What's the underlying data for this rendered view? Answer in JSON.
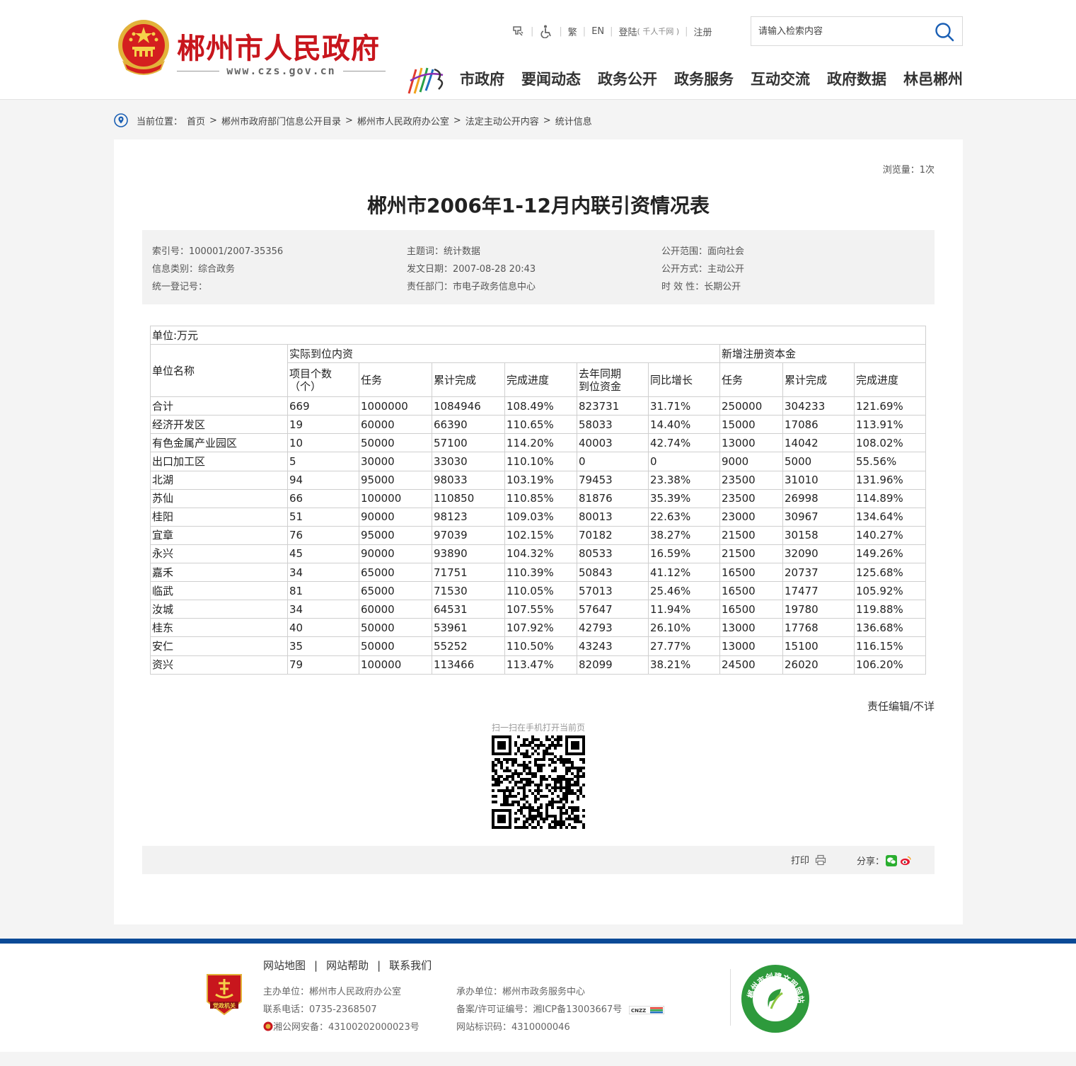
{
  "header": {
    "site_title": "郴州市人民政府",
    "site_url": "www.czs.gov.cn",
    "top_links": {
      "traditional": "繁",
      "english": "EN",
      "login": "登陆",
      "login_note": "( 千人千网 )",
      "register": "注册"
    },
    "search_placeholder": "请输入检索内容",
    "nav": [
      "市政府",
      "要闻动态",
      "政务公开",
      "政务服务",
      "互动交流",
      "政府数据",
      "林邑郴州"
    ]
  },
  "breadcrumb": {
    "label": "当前位置：",
    "items": [
      "首页",
      "郴州市政府部门信息公开目录",
      "郴州市人民政府办公室",
      "法定主动公开内容",
      "统计信息"
    ]
  },
  "article": {
    "views": "浏览量：1次",
    "title": "郴州市2006年1-12月内联引资情况表",
    "meta": {
      "index_no": "索引号：100001/2007-35356",
      "subject": "主题词：统计数据",
      "scope": "公开范围：面向社会",
      "category": "信息类别：综合政务",
      "date": "发文日期：2007-08-28 20:43",
      "method": "公开方式：主动公开",
      "reg_no": "统一登记号：",
      "dept": "责任部门：市电子政务信息中心",
      "validity": "时 效 性：长期公开"
    },
    "editor": "责任编辑/不详",
    "qr_caption": "扫一扫在手机打开当前页",
    "print_label": "打印",
    "share_label": "分享："
  },
  "table": {
    "unit": "单位:万元",
    "col_unit_name": "单位名称",
    "group1": "实际到位内资",
    "group2": "新增注册资本金",
    "subheaders": [
      "项目个数\n（个）",
      "任务",
      "累计完成",
      "完成进度",
      "去年同期\n到位资金",
      "同比增长",
      "任务",
      "累计完成",
      "完成进度"
    ],
    "rows": [
      [
        "合计",
        "669",
        "1000000",
        "1084946",
        "108.49%",
        "823731",
        "31.71%",
        "250000",
        "304233",
        "121.69%"
      ],
      [
        "经济开发区",
        "19",
        "60000",
        "66390",
        "110.65%",
        "58033",
        "14.40%",
        "15000",
        "17086",
        "113.91%"
      ],
      [
        "有色金属产业园区",
        "10",
        "50000",
        "57100",
        "114.20%",
        "40003",
        "42.74%",
        "13000",
        "14042",
        "108.02%"
      ],
      [
        "出口加工区",
        "5",
        "30000",
        "33030",
        "110.10%",
        "0",
        "0",
        "9000",
        "5000",
        "55.56%"
      ],
      [
        "北湖",
        "94",
        "95000",
        "98033",
        "103.19%",
        "79453",
        "23.38%",
        "23500",
        "31010",
        "131.96%"
      ],
      [
        "苏仙",
        "66",
        "100000",
        "110850",
        "110.85%",
        "81876",
        "35.39%",
        "23500",
        "26998",
        "114.89%"
      ],
      [
        "桂阳",
        "51",
        "90000",
        "98123",
        "109.03%",
        "80013",
        "22.63%",
        "23000",
        "30967",
        "134.64%"
      ],
      [
        "宜章",
        "76",
        "95000",
        "97039",
        "102.15%",
        "70182",
        "38.27%",
        "21500",
        "30158",
        "140.27%"
      ],
      [
        "永兴",
        "45",
        "90000",
        "93890",
        "104.32%",
        "80533",
        "16.59%",
        "21500",
        "32090",
        "149.26%"
      ],
      [
        "嘉禾",
        "34",
        "65000",
        "71751",
        "110.39%",
        "50843",
        "41.12%",
        "16500",
        "20737",
        "125.68%"
      ],
      [
        "临武",
        "81",
        "65000",
        "71530",
        "110.05%",
        "57013",
        "25.46%",
        "16500",
        "17477",
        "105.92%"
      ],
      [
        "汝城",
        "34",
        "60000",
        "64531",
        "107.55%",
        "57647",
        "11.94%",
        "16500",
        "19780",
        "119.88%"
      ],
      [
        "桂东",
        "40",
        "50000",
        "53961",
        "107.92%",
        "42793",
        "26.10%",
        "13000",
        "17768",
        "136.68%"
      ],
      [
        "安仁",
        "35",
        "50000",
        "55252",
        "110.50%",
        "43243",
        "27.77%",
        "13000",
        "15100",
        "116.15%"
      ],
      [
        "资兴",
        "79",
        "100000",
        "113466",
        "113.47%",
        "82099",
        "38.21%",
        "24500",
        "26020",
        "106.20%"
      ]
    ]
  },
  "footer": {
    "links": [
      "网站地图",
      "网站帮助",
      "联系我们"
    ],
    "sponsor": "主办单位：郴州市人民政府办公室",
    "phone": "联系电话：0735-2368507",
    "police": "湘公网安备：43100202000023号",
    "operator": "承办单位：郴州市政务服务中心",
    "icp": "备案/许可证编号：湘ICP备13003667号",
    "site_id": "网站标识码：4310000046",
    "cnzz": "CNZZ",
    "party_badge_text": "党政机关",
    "civil_badge_text": "郴州市创建文明网站"
  },
  "colors": {
    "brand_red": "#c8161d",
    "footer_blue": "#0b4a96",
    "panel_bg": "#ffffff",
    "meta_bg": "#f2f2f2"
  }
}
